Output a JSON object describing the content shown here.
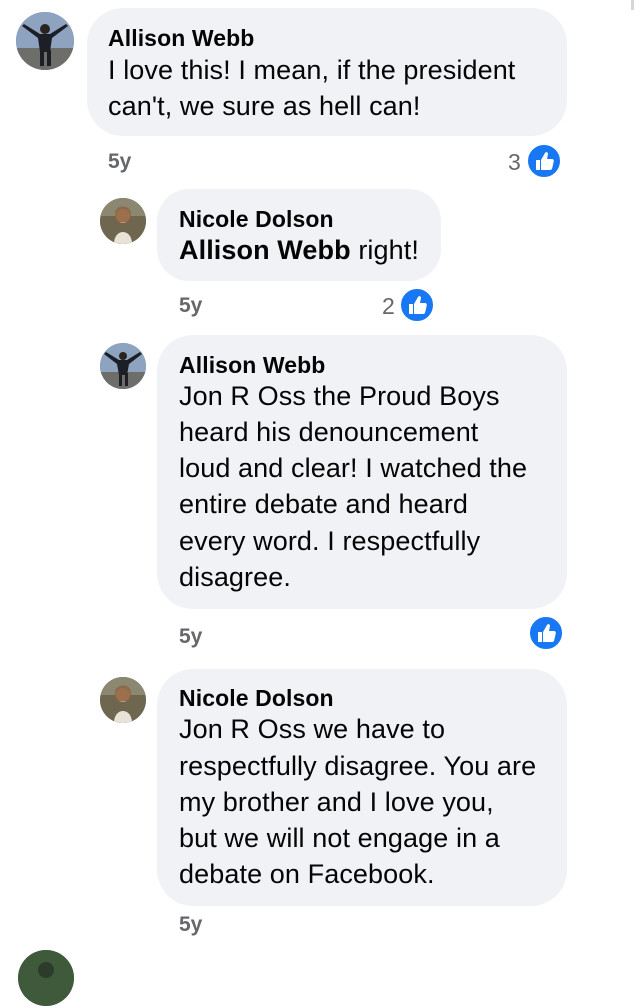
{
  "comments": [
    {
      "author": "Allison Webb",
      "lines": [
        "I love this! I mean, if the president",
        "can't, we sure as hell can!"
      ],
      "time": "5y",
      "reaction_count": "3",
      "reaction": "like-icon"
    },
    {
      "author": "Nicole Dolson",
      "mention": "Allison Webb",
      "text_after_mention": " right!",
      "time": "5y",
      "reaction_count": "2",
      "reaction": "like-icon"
    },
    {
      "author": "Allison Webb",
      "lines": [
        "Jon R Oss the Proud Boys",
        "heard his denouncement",
        "loud and clear! I watched the",
        "entire debate and heard",
        "every word. I respectfully",
        "disagree."
      ],
      "time": "5y",
      "reaction_count": "",
      "reaction": "like-icon"
    },
    {
      "author": "Nicole Dolson",
      "lines": [
        "Jon R Oss we have to",
        "respectfully disagree. You are",
        "my brother and I love you,",
        "but we will not engage in a",
        "debate on Facebook."
      ],
      "time": "5y"
    }
  ],
  "colors": {
    "bubble": "#f0f2f5",
    "name": "#050505",
    "meta": "#65676b",
    "like": "#1877f2"
  }
}
